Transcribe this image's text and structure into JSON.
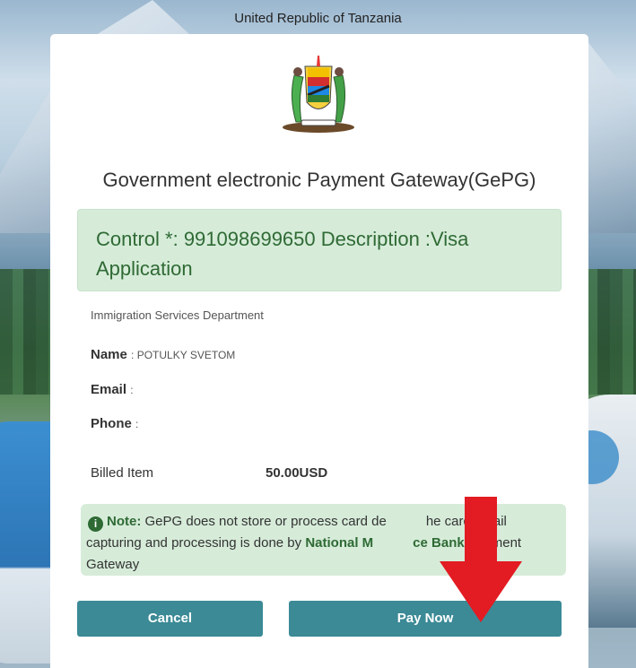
{
  "header": {
    "country": "United Republic of Tanzania"
  },
  "gateway": {
    "title": "Government electronic Payment Gateway(GePG)"
  },
  "control": {
    "text": "Control *: 991098699650 Description :Visa Application"
  },
  "department": "Immigration Services Department",
  "payer": {
    "name_label": "Name",
    "name_value": ": POTULKY SVETOM",
    "email_label": "Email",
    "email_value": ":",
    "phone_label": "Phone",
    "phone_value": ":"
  },
  "billing": {
    "item_label": "Billed Item",
    "amount": "50.00",
    "currency": "USD"
  },
  "note": {
    "icon": "info-icon",
    "label": "Note:",
    "text_1": " GePG does not store or process card de",
    "text_2": "he card detail capturing and processing is done by ",
    "bank": "National M",
    "bank_2": "ce Bank",
    "text_3": " Payment Gateway"
  },
  "buttons": {
    "cancel": "Cancel",
    "pay": "Pay Now"
  },
  "colors": {
    "accent": "#3b8a96",
    "success_bg": "#d6ecd9",
    "success_text": "#2f6a34",
    "arrow": "#e31b23"
  }
}
